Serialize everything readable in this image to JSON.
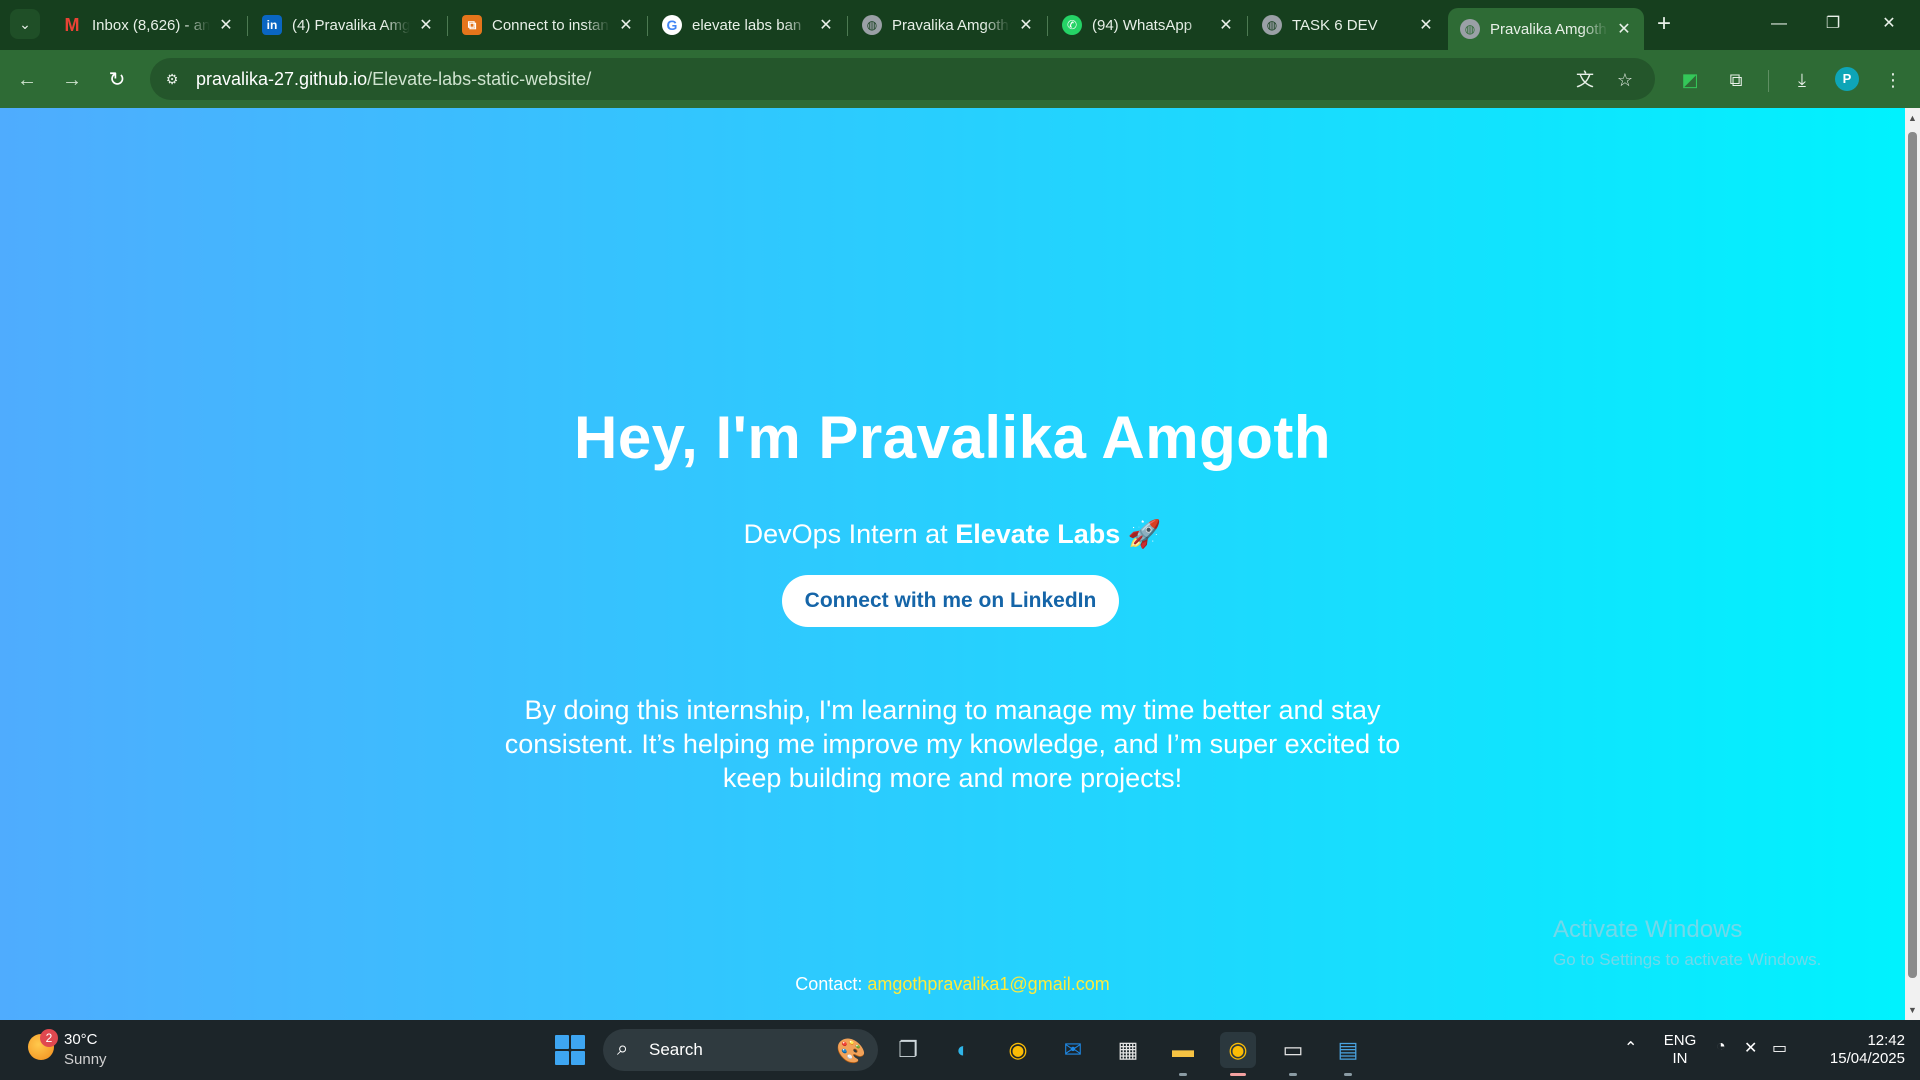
{
  "browser": {
    "tabs": [
      {
        "title": "Inbox (8,626) - an",
        "icon": "gmail-icon",
        "color": "#ea4335"
      },
      {
        "title": "(4) Pravalika Amg",
        "icon": "linkedin-icon",
        "color": "#0a66c2"
      },
      {
        "title": "Connect to instan",
        "icon": "aws-connect-icon",
        "color": "#e4751b"
      },
      {
        "title": "elevate labs ban",
        "icon": "google-icon",
        "color": "#4285f4"
      },
      {
        "title": "Pravalika Amgoth",
        "icon": "globe-icon",
        "color": "#9aa0a6"
      },
      {
        "title": "(94) WhatsApp",
        "icon": "whatsapp-icon",
        "color": "#25d366"
      },
      {
        "title": "TASK 6 DEV",
        "icon": "globe-icon",
        "color": "#9aa0a6"
      },
      {
        "title": "Pravalika Amgoth",
        "icon": "globe-icon",
        "color": "#9aa0a6",
        "active": true
      }
    ],
    "url_host": "pravalika-27.github.io",
    "url_path": "/Elevate-labs-static-website/",
    "profile_initial": "P",
    "theme_color": "#2e6b35"
  },
  "page": {
    "heading": "Hey, I'm Pravalika Amgoth",
    "subtitle_prefix": "DevOps Intern at ",
    "subtitle_company": "Elevate Labs",
    "subtitle_emoji": "🚀",
    "cta_label": "Connect with me on LinkedIn",
    "about": "By doing this internship, I'm learning to manage my time better and stay consistent. It’s helping me improve my knowledge, and I’m super excited to keep building more and more projects!",
    "contact_label": "Contact: ",
    "contact_email": "amgothpravalika1@gmail.com",
    "gradient_start": "#4facfe",
    "gradient_end": "#00f2fe",
    "email_color": "#ffeb3b"
  },
  "watermark": {
    "line1": "Activate Windows",
    "line2": "Go to Settings to activate Windows."
  },
  "taskbar": {
    "weather_badge": "2",
    "temperature": "30°C",
    "condition": "Sunny",
    "search_label": "Search",
    "lang_top": "ENG",
    "lang_bottom": "IN",
    "time": "12:42",
    "date": "15/04/2025"
  }
}
